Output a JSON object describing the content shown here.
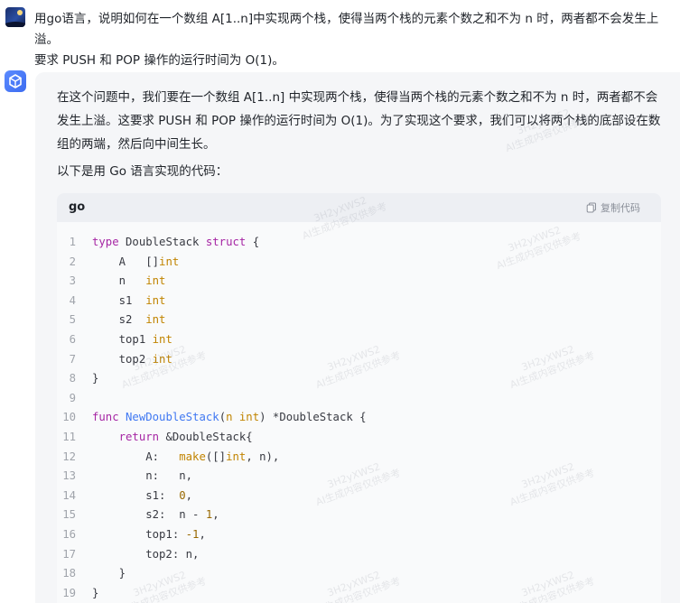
{
  "user_message": {
    "line1": "用go语言，说明如何在一个数组 A[1..n]中实现两个栈，使得当两个栈的元素个数之和不为 n 时，两者都不会发生上溢。",
    "line2": "要求 PUSH 和 POP 操作的运行时间为 O(1)。"
  },
  "bot_message": {
    "para1_line1": "在这个问题中，我们要在一个数组 A[1..n] 中实现两个栈，使得当两个栈的元素个数之和不为 n 时，两者都不会",
    "para1_line2": "发生上溢。这要求 PUSH 和 POP 操作的运行时间为 O(1)。为了实现这个要求，我们可以将两个栈的底部设在数",
    "para1_line3": "组的两端，然后向中间生长。",
    "para2": "以下是用 Go 语言实现的代码："
  },
  "code_block": {
    "language": "go",
    "copy_label": "复制代码",
    "lines": [
      {
        "n": "1",
        "tokens": [
          [
            "kw",
            "type"
          ],
          [
            "pl",
            " DoubleStack "
          ],
          [
            "kw",
            "struct"
          ],
          [
            "pl",
            " {"
          ]
        ]
      },
      {
        "n": "2",
        "tokens": [
          [
            "pl",
            "    A   []"
          ],
          [
            "ty",
            "int"
          ]
        ]
      },
      {
        "n": "3",
        "tokens": [
          [
            "pl",
            "    n   "
          ],
          [
            "ty",
            "int"
          ]
        ]
      },
      {
        "n": "4",
        "tokens": [
          [
            "pl",
            "    s1  "
          ],
          [
            "ty",
            "int"
          ]
        ]
      },
      {
        "n": "5",
        "tokens": [
          [
            "pl",
            "    s2  "
          ],
          [
            "ty",
            "int"
          ]
        ]
      },
      {
        "n": "6",
        "tokens": [
          [
            "pl",
            "    top1 "
          ],
          [
            "ty",
            "int"
          ]
        ]
      },
      {
        "n": "7",
        "tokens": [
          [
            "pl",
            "    top2 "
          ],
          [
            "ty",
            "int"
          ]
        ]
      },
      {
        "n": "8",
        "tokens": [
          [
            "pl",
            "}"
          ]
        ]
      },
      {
        "n": "9",
        "tokens": []
      },
      {
        "n": "10",
        "tokens": [
          [
            "kw",
            "func"
          ],
          [
            "pl",
            " "
          ],
          [
            "fn",
            "NewDoubleStack"
          ],
          [
            "pl",
            "("
          ],
          [
            "ty",
            "n int"
          ],
          [
            "pl",
            ") *DoubleStack {"
          ]
        ]
      },
      {
        "n": "11",
        "tokens": [
          [
            "pl",
            "    "
          ],
          [
            "kw",
            "return"
          ],
          [
            "pl",
            " &DoubleStack{"
          ]
        ]
      },
      {
        "n": "12",
        "tokens": [
          [
            "pl",
            "        A:   "
          ],
          [
            "ty",
            "make"
          ],
          [
            "pl",
            "([]"
          ],
          [
            "ty",
            "int"
          ],
          [
            "pl",
            ", n),"
          ]
        ]
      },
      {
        "n": "13",
        "tokens": [
          [
            "pl",
            "        n:   n,"
          ]
        ]
      },
      {
        "n": "14",
        "tokens": [
          [
            "pl",
            "        s1:  "
          ],
          [
            "nm",
            "0"
          ],
          [
            "pl",
            ","
          ]
        ]
      },
      {
        "n": "15",
        "tokens": [
          [
            "pl",
            "        s2:  n - "
          ],
          [
            "nm",
            "1"
          ],
          [
            "pl",
            ","
          ]
        ]
      },
      {
        "n": "16",
        "tokens": [
          [
            "pl",
            "        top1: "
          ],
          [
            "nm",
            "-1"
          ],
          [
            "pl",
            ","
          ]
        ]
      },
      {
        "n": "17",
        "tokens": [
          [
            "pl",
            "        top2: n,"
          ]
        ]
      },
      {
        "n": "18",
        "tokens": [
          [
            "pl",
            "    }"
          ]
        ]
      },
      {
        "n": "19",
        "tokens": [
          [
            "pl",
            "}"
          ]
        ]
      }
    ]
  },
  "watermark": {
    "line1": "3H2yXWS2",
    "line2": "AI生成内容仅供参考"
  },
  "colors": {
    "keyword": "#a626a4",
    "type": "#c18401",
    "function": "#4078f2",
    "number": "#986801",
    "accent": "#3d6cf0"
  }
}
